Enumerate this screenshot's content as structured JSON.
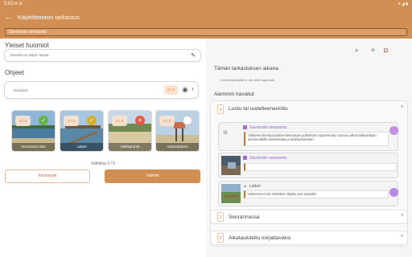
{
  "status_bar": {
    "time": "5:02"
  },
  "header": {
    "title": "Käyttöönoton tarkastus",
    "place_chip": "Savokoski uimaranta"
  },
  "left": {
    "general_notes_title": "Yleiset huomiot",
    "general_notes_value": "Alueella on paljon lapsia",
    "instructions_title": "Ohjeet",
    "instructions_field_label": "Alaohjeet",
    "instructions_badge": "0 / 3",
    "cards": [
      {
        "label": "Uimaranta-alue",
        "count": "4 / 4",
        "status": "done",
        "status_color": "#66b24c"
      },
      {
        "label": "Laituri",
        "count": "3 / 3",
        "status": "done",
        "status_color": "#d0b02c"
      },
      {
        "label": "Hiekkaranta",
        "count": "0 / 3",
        "status": "failed",
        "status_color": "#e05a45"
      },
      {
        "label": "Valvontatorni",
        "count": "0 / 3",
        "status": "none",
        "status_color": "#ffffff"
      }
    ],
    "progress_text": "Valmiina 3 / 5",
    "interrupt_label": "Keskeytä",
    "done_label": "Valmis",
    "accent": "#d28f53"
  },
  "right": {
    "toolbar_icons": [
      "search-icon",
      "magic-wand-icon",
      "camera-icon"
    ],
    "this_inspection_title": "Tämän tarkastuksen aikana",
    "this_inspection_empty": "Kohdeeseisijöitä ei ole vielä raportoitu.",
    "previous_title": "Aiemmin havaitut",
    "groups": [
      {
        "badge": "3",
        "title": "Luotu tai uudelleenavioitu",
        "expanded": true
      },
      {
        "badge": "1",
        "title": "Seurannassa",
        "expanded": false
      },
      {
        "badge": "2",
        "title": "Aikataulutettu korjattavaksi",
        "expanded": false
      }
    ],
    "findings": [
      {
        "place": "Savokoski uimaranta",
        "note": "Välineen kiinnityslaukset keinantain puhdistaa sopamenaan casvuo ulkomaalaiseltaan toiminnallalta tarkastetaja ja tuhimuhotetaan."
      },
      {
        "place": "Savokoski uimaranta",
        "note": ""
      },
      {
        "place": "Laituri",
        "note": "Huleessä ei ole riittävästi ohjattu pois alueelta."
      }
    ]
  }
}
